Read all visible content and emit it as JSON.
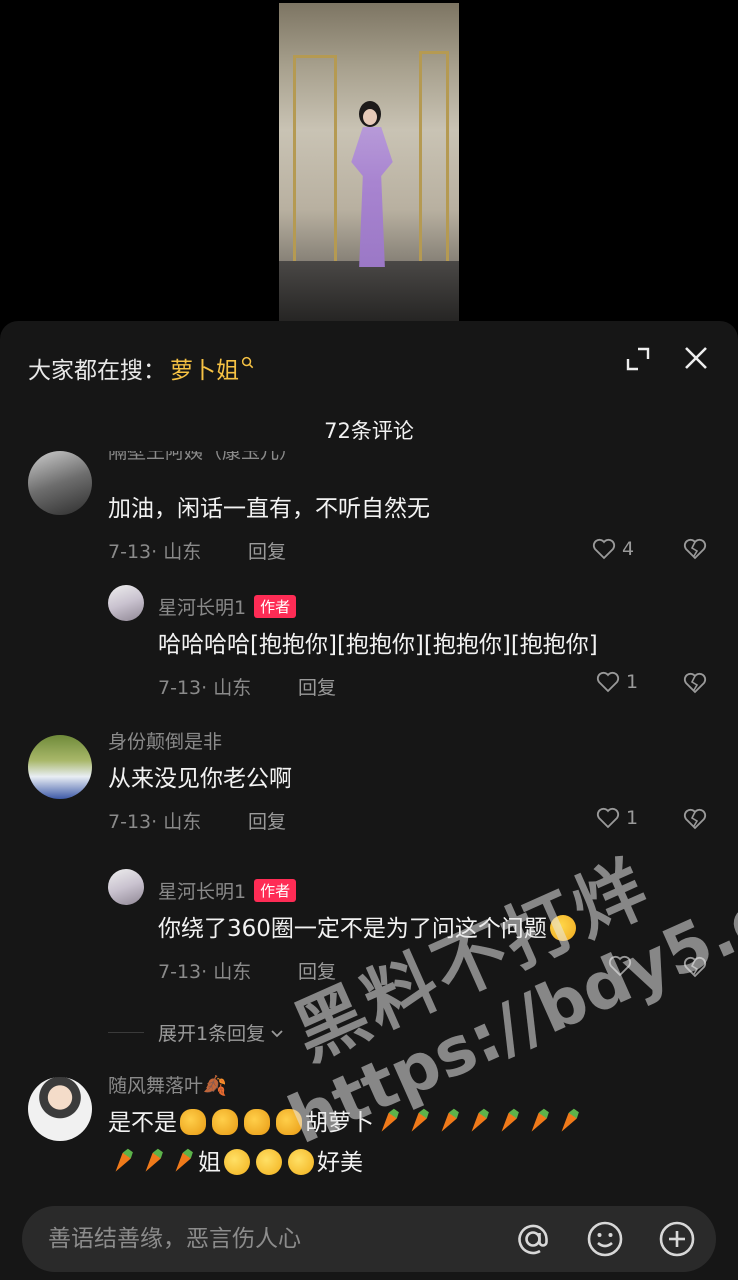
{
  "search": {
    "prefix": "大家都在搜：",
    "term": "萝卜姐"
  },
  "comments_header": {
    "count_label": "72条评论"
  },
  "comments": [
    {
      "username": "隔壁王阿姨（康玉儿）",
      "content": "加油，闲话一直有，不听自然无",
      "meta": "7-13· 山东",
      "reply_label": "回复",
      "likes": "4",
      "replies": [
        {
          "username": "星河长明1",
          "badge": "作者",
          "content": "哈哈哈哈[抱抱你][抱抱你][抱抱你][抱抱你]",
          "meta": "7-13· 山东",
          "reply_label": "回复",
          "likes": "1"
        }
      ]
    },
    {
      "username": "身份颠倒是非",
      "content": "从来没见你老公啊",
      "meta": "7-13· 山东",
      "reply_label": "回复",
      "likes": "1",
      "replies": [
        {
          "username": "星河长明1",
          "badge": "作者",
          "content": "你绕了360圈一定不是为了问这个问题",
          "meta": "7-13· 山东",
          "reply_label": "回复",
          "likes": ""
        }
      ],
      "expand_label": "展开1条回复"
    },
    {
      "username": "随风舞落叶🍂",
      "content_line1_a": "是不是",
      "content_line1_b": "胡萝卜",
      "content_line2_a": "姐",
      "content_line2_b": "好美"
    }
  ],
  "input": {
    "placeholder": "善语结善缘，恶言伤人心"
  },
  "watermark": {
    "line1": "黑料不打烊",
    "line2": "https://bdy5.co"
  },
  "colors": {
    "panel_bg": "#161616",
    "accent_search": "#f6c244",
    "author_badge": "#fe2c55"
  }
}
